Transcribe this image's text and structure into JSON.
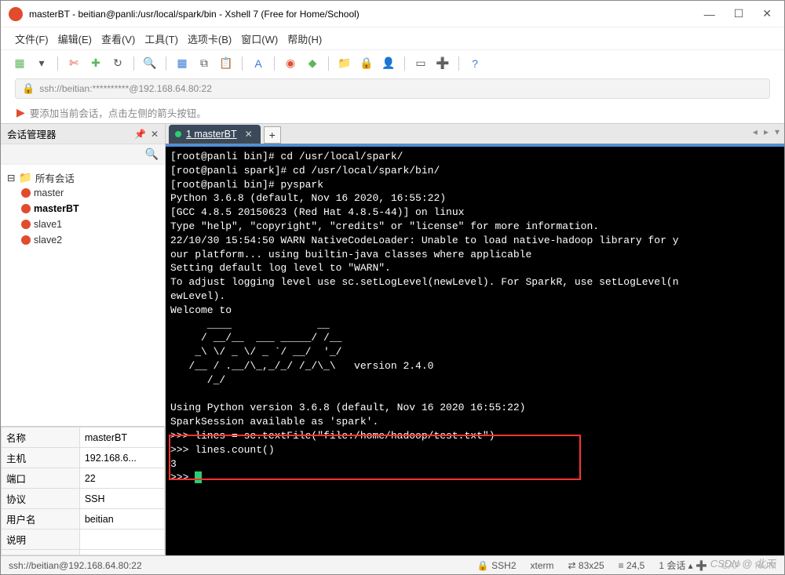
{
  "titlebar": {
    "title": "masterBT - beitian@panli:/usr/local/spark/bin - Xshell 7 (Free for Home/School)"
  },
  "menubar": {
    "file": "文件(F)",
    "edit": "编辑(E)",
    "view": "查看(V)",
    "tools": "工具(T)",
    "tabs": "选项卡(B)",
    "window": "窗口(W)",
    "help": "帮助(H)"
  },
  "addressbar": {
    "text": "ssh://beitian:**********@192.168.64.80:22"
  },
  "tipbar": {
    "text": "要添加当前会话，点击左侧的箭头按钮。"
  },
  "sidebar": {
    "title": "会话管理器",
    "root": "所有会话",
    "sessions": [
      "master",
      "masterBT",
      "slave1",
      "slave2"
    ],
    "selected": "masterBT"
  },
  "props": {
    "rows": [
      {
        "k": "名称",
        "v": "masterBT"
      },
      {
        "k": "主机",
        "v": "192.168.6..."
      },
      {
        "k": "端口",
        "v": "22"
      },
      {
        "k": "协议",
        "v": "SSH"
      },
      {
        "k": "用户名",
        "v": "beitian"
      },
      {
        "k": "说明",
        "v": ""
      }
    ]
  },
  "tab": {
    "name": "1 masterBT"
  },
  "terminal": {
    "lines": [
      "[root@panli bin]# cd /usr/local/spark/",
      "[root@panli spark]# cd /usr/local/spark/bin/",
      "[root@panli bin]# pyspark",
      "Python 3.6.8 (default, Nov 16 2020, 16:55:22) ",
      "[GCC 4.8.5 20150623 (Red Hat 4.8.5-44)] on linux",
      "Type \"help\", \"copyright\", \"credits\" or \"license\" for more information.",
      "22/10/30 15:54:50 WARN NativeCodeLoader: Unable to load native-hadoop library for y",
      "our platform... using builtin-java classes where applicable",
      "Setting default log level to \"WARN\".",
      "To adjust logging level use sc.setLogLevel(newLevel). For SparkR, use setLogLevel(n",
      "ewLevel).",
      "Welcome to",
      "      ____              __",
      "     / __/__  ___ _____/ /__",
      "    _\\ \\/ _ \\/ _ `/ __/  '_/",
      "   /__ / .__/\\_,_/_/ /_/\\_\\   version 2.4.0",
      "      /_/",
      "",
      "Using Python version 3.6.8 (default, Nov 16 2020 16:55:22)",
      "SparkSession available as 'spark'.",
      ">>> lines = sc.textFile(\"file:/home/hadoop/test.txt\")",
      ">>> lines.count()",
      "3",
      ">>> "
    ]
  },
  "statusbar": {
    "conn": "ssh://beitian@192.168.64.80:22",
    "proto": "SSH2",
    "term": "xterm",
    "size": "83x25",
    "pos": "24,5",
    "sess": "1 会话",
    "cap": "CAP",
    "num": "NUM"
  },
  "watermark": "CSDN @ 北天"
}
